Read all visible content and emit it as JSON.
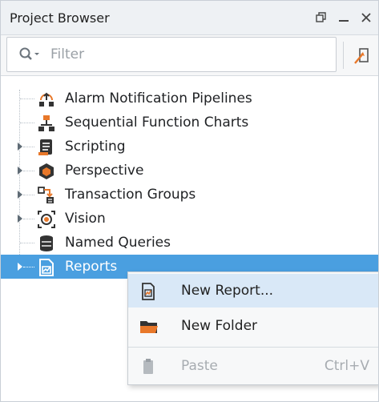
{
  "panel": {
    "title": "Project Browser"
  },
  "filter": {
    "placeholder": "Filter",
    "value": ""
  },
  "tree": {
    "items": [
      {
        "label": "Alarm Notification Pipelines",
        "icon": "alarm-pipeline-icon",
        "expandable": false
      },
      {
        "label": "Sequential Function Charts",
        "icon": "sfc-icon",
        "expandable": false
      },
      {
        "label": "Scripting",
        "icon": "scripting-icon",
        "expandable": true
      },
      {
        "label": "Perspective",
        "icon": "perspective-icon",
        "expandable": true
      },
      {
        "label": "Transaction Groups",
        "icon": "transaction-groups-icon",
        "expandable": true
      },
      {
        "label": "Vision",
        "icon": "vision-icon",
        "expandable": true
      },
      {
        "label": "Named Queries",
        "icon": "named-queries-icon",
        "expandable": false
      },
      {
        "label": "Reports",
        "icon": "reports-icon",
        "expandable": true,
        "selected": true
      }
    ]
  },
  "context_menu": {
    "items": [
      {
        "label": "New Report...",
        "icon": "new-report-icon",
        "shortcut": "",
        "enabled": true,
        "hovered": true
      },
      {
        "label": "New Folder",
        "icon": "folder-icon",
        "shortcut": "",
        "enabled": true
      },
      {
        "label": "Paste",
        "icon": "paste-icon",
        "shortcut": "Ctrl+V",
        "enabled": false
      }
    ]
  },
  "colors": {
    "selection": "#4a9fe0",
    "menu_hover": "#d9e8f7",
    "accent_orange": "#e8782a"
  }
}
